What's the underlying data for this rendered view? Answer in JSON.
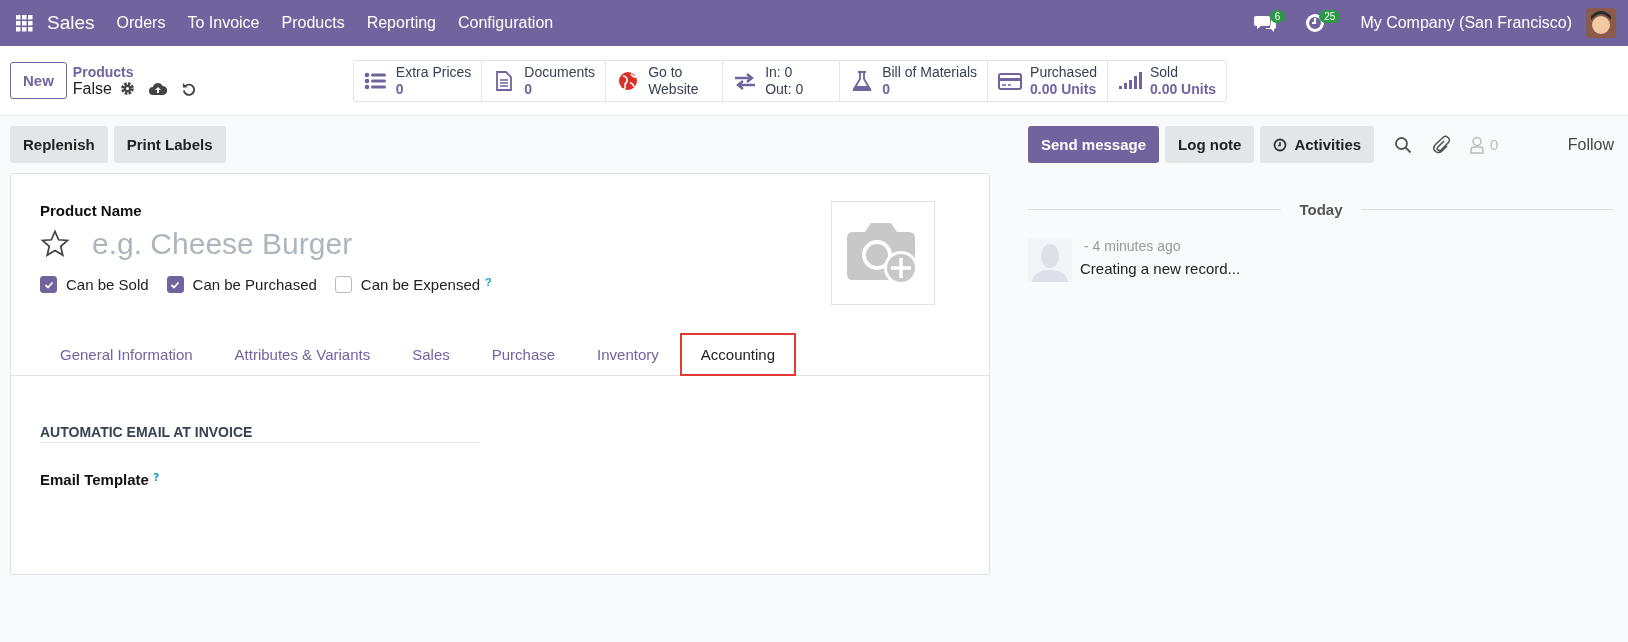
{
  "navbar": {
    "app": "Sales",
    "menu": [
      "Orders",
      "To Invoice",
      "Products",
      "Reporting",
      "Configuration"
    ],
    "messages_badge": "6",
    "activities_badge": "25",
    "company": "My Company (San Francisco)"
  },
  "control_panel": {
    "new_button": "New",
    "breadcrumb": "Products",
    "record": "False",
    "smart_buttons": [
      {
        "kind": "stat",
        "label": "Extra Prices",
        "value": "0"
      },
      {
        "kind": "stat",
        "label": "Documents",
        "value": "0"
      },
      {
        "kind": "text",
        "label": "Go to",
        "value": "Website"
      },
      {
        "kind": "text",
        "label": "In: 0",
        "value": "Out: 0"
      },
      {
        "kind": "stat",
        "label": "Bill of Materials",
        "value": "0"
      },
      {
        "kind": "stat",
        "label": "Purchased",
        "value": "0.00 Units"
      },
      {
        "kind": "stat",
        "label": "Sold",
        "value": "0.00 Units"
      }
    ]
  },
  "action_buttons": [
    "Replenish",
    "Print Labels"
  ],
  "form": {
    "name_label": "Product Name",
    "name_placeholder": "e.g. Cheese Burger",
    "starred": false,
    "checkboxes": [
      {
        "label": "Can be Sold",
        "checked": true
      },
      {
        "label": "Can be Purchased",
        "checked": true
      },
      {
        "label": "Can be Expensed",
        "checked": false,
        "help": "?"
      }
    ],
    "tabs": [
      {
        "label": "General Information",
        "selected": false
      },
      {
        "label": "Attributes & Variants",
        "selected": false
      },
      {
        "label": "Sales",
        "selected": false
      },
      {
        "label": "Purchase",
        "selected": false
      },
      {
        "label": "Inventory",
        "selected": false
      },
      {
        "label": "Accounting",
        "selected": true
      }
    ],
    "section_title": "AUTOMATIC EMAIL AT INVOICE",
    "field_label": "Email Template",
    "field_help": "?"
  },
  "chatter": {
    "buttons": [
      "Send message",
      "Log note",
      "Activities"
    ],
    "followers": "0",
    "follow": "Follow",
    "date_separator": "Today",
    "messages": [
      {
        "time": "- 4 minutes ago",
        "body": "Creating a new record..."
      }
    ]
  }
}
